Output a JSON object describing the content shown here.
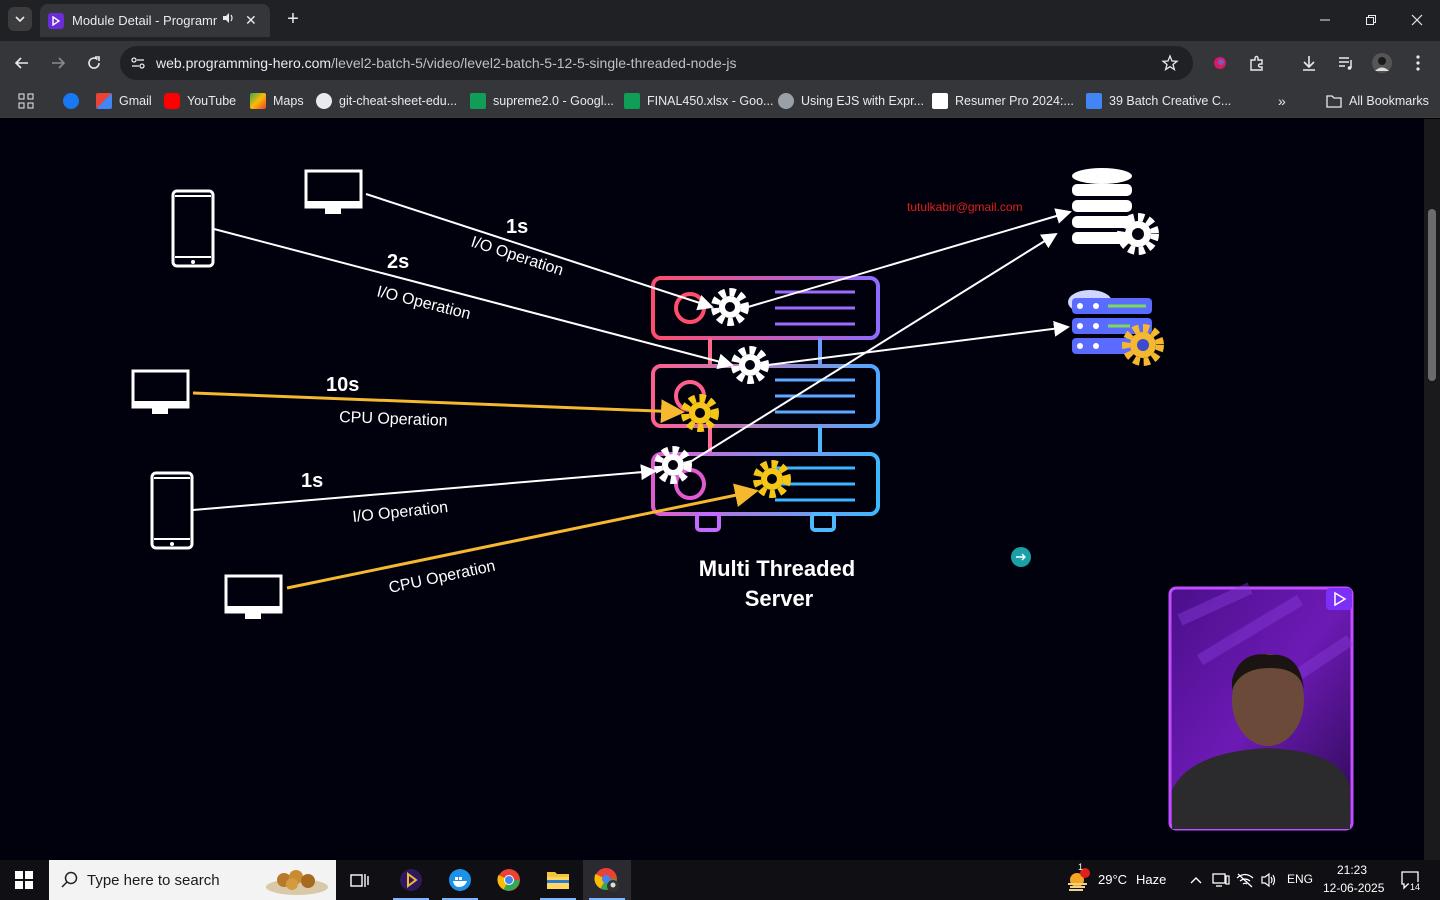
{
  "browser": {
    "tab_title": "Module Detail - Programmi",
    "url_host": "web.programming-hero.com",
    "url_path": "/level2-batch-5/video/level2-batch-5-12-5-single-threaded-node-js",
    "bookmarks": [
      {
        "label": "",
        "icon": "facebook-icon",
        "color": "#1877f2"
      },
      {
        "label": "Gmail",
        "icon": "gmail-icon",
        "color": "#ea4335"
      },
      {
        "label": "YouTube",
        "icon": "youtube-icon",
        "color": "#ff0000"
      },
      {
        "label": "Maps",
        "icon": "maps-icon",
        "color": "#34a853"
      },
      {
        "label": "git-cheat-sheet-edu...",
        "icon": "github-icon",
        "color": "#e8eaed"
      },
      {
        "label": "supreme2.0 - Googl...",
        "icon": "sheets-icon",
        "color": "#0f9d58"
      },
      {
        "label": "FINAL450.xlsx - Goo...",
        "icon": "sheets-icon",
        "color": "#0f9d58"
      },
      {
        "label": "Using EJS with Expr...",
        "icon": "github-icon",
        "color": "#e8eaed"
      },
      {
        "label": "Resumer Pro 2024:...",
        "icon": "resumer-icon",
        "color": "#ffffff"
      },
      {
        "label": "39 Batch Creative C...",
        "icon": "docs-icon",
        "color": "#4285f4"
      }
    ],
    "all_bookmarks": "All Bookmarks"
  },
  "slide": {
    "watermark": "tutulkabir@gmail.com",
    "labels": {
      "t1": "1s",
      "op1": "I/O Operation",
      "t2": "2s",
      "op2": "I/O Operation",
      "t3": "10s",
      "op3": "CPU Operation",
      "t4": "1s",
      "op4": "I/O Operation",
      "op5": "CPU Operation"
    },
    "server_title_line1": "Multi Threaded",
    "server_title_line2": "Server"
  },
  "taskbar": {
    "search_placeholder": "Type here to search",
    "weather_temp": "29°C",
    "weather_cond": "Haze",
    "language": "ENG",
    "time": "21:23",
    "date": "12-06-2025",
    "notifications": "14",
    "weather_badge": "1"
  },
  "colors": {
    "accent_purple": "#7b2ff7",
    "io_line": "#ffffff",
    "cpu_line": "#f5b82e",
    "watermark": "#e0201a"
  }
}
